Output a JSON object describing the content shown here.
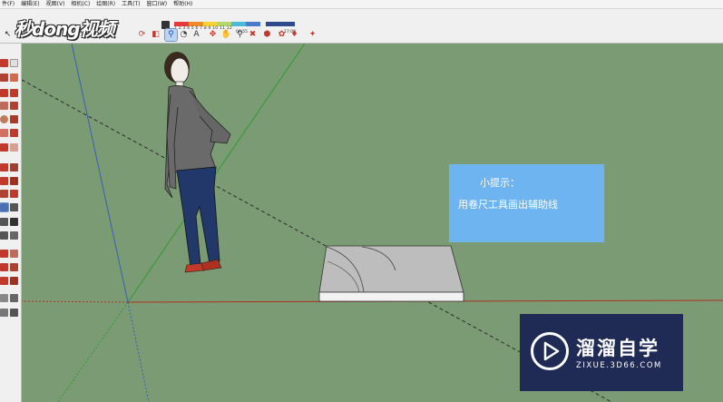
{
  "menu": {
    "items": [
      "件(F)",
      "编辑(E)",
      "视图(V)",
      "相机(C)",
      "绘图(R)",
      "工具(T)",
      "窗口(W)",
      "帮助(H)"
    ]
  },
  "brand": {
    "text": "秒dong视频"
  },
  "timeline": {
    "months": "1 2 3 4 5 6 7 8 9 10 11 12",
    "time_start": "06:55",
    "time_end": "17:00"
  },
  "tip": {
    "title": "小提示：",
    "body": "用卷尺工具画出辅助线"
  },
  "watermark": {
    "title": "溜溜自学",
    "subtitle": "ZIXUE.3D66.COM"
  },
  "colors": {
    "viewport_bg": "#7b9b74",
    "tip_bg": "#6eb4f0",
    "watermark_bg": "#1f2a55",
    "axis_red": "#b0301e",
    "axis_green": "#2e9a2e",
    "axis_blue": "#3a5fb5"
  }
}
